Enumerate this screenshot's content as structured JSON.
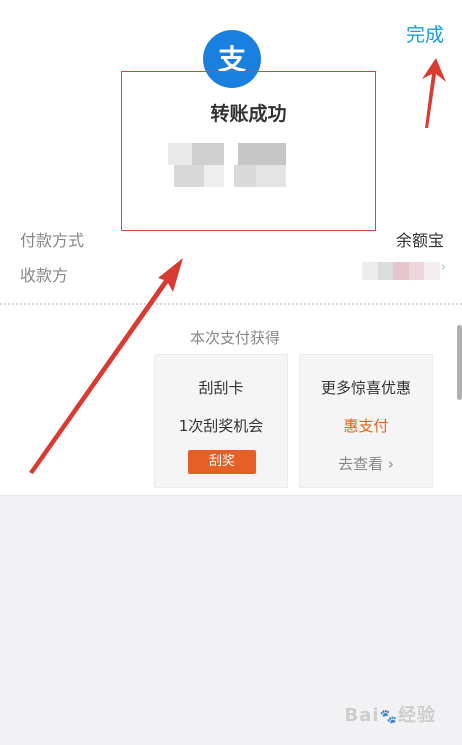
{
  "header": {
    "done_label": "完成"
  },
  "logo": {
    "glyph": "支",
    "icon": "alipay-logo-icon",
    "color": "#1a80df"
  },
  "result": {
    "title": "转账成功"
  },
  "details": {
    "payment_method_label": "付款方式",
    "payment_method_value": "余额宝",
    "payee_label": "收款方",
    "payee_chevron": "›"
  },
  "rewards": {
    "section_label": "本次支付获得",
    "scratch_card": {
      "title": "刮刮卡",
      "subtitle": "1次刮奖机会",
      "button_label": "刮奖"
    },
    "more_offers": {
      "title": "更多惊喜优惠",
      "highlight": "惠支付",
      "link_label": "去查看 ›"
    }
  },
  "watermark": {
    "text": "Bai",
    "paw": "🐾",
    "suffix": "经验"
  },
  "colors": {
    "accent": "#1a9fd9",
    "brand_blue": "#1a80df",
    "annotation_red": "#e0423a",
    "reward_orange": "#e55f27"
  }
}
